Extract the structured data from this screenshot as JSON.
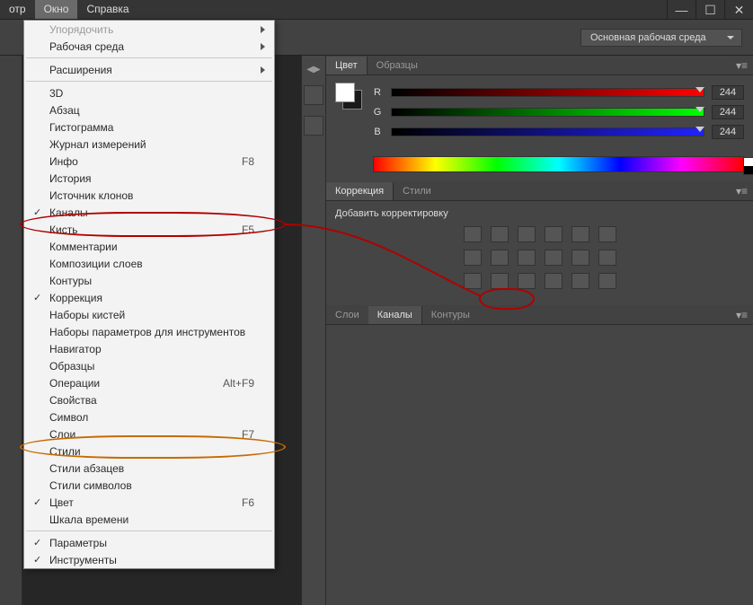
{
  "menubar": {
    "truncated_item": "отр",
    "window": "Окно",
    "help": "Справка"
  },
  "window_controls": {
    "min": "—",
    "restore": "☐",
    "close": "✕"
  },
  "workspace_selector": "Основная рабочая среда",
  "dropdown": {
    "arrange": "Упорядочить",
    "workspace_env": "Рабочая среда",
    "extensions": "Расширения",
    "three_d": "3D",
    "paragraph": "Абзац",
    "histogram": "Гистограмма",
    "measure_log": "Журнал измерений",
    "info": "Инфо",
    "info_sc": "F8",
    "history": "История",
    "clone_source": "Источник клонов",
    "channels": "Каналы",
    "brush": "Кисть",
    "brush_sc": "F5",
    "comments": "Комментарии",
    "layer_comps": "Композиции слоев",
    "paths": "Контуры",
    "adjustments": "Коррекция",
    "brush_presets": "Наборы кистей",
    "tool_presets": "Наборы параметров для инструментов",
    "navigator": "Навигатор",
    "swatches": "Образцы",
    "actions": "Операции",
    "actions_sc": "Alt+F9",
    "properties": "Свойства",
    "character": "Символ",
    "layers": "Слои",
    "layers_sc": "F7",
    "styles": "Стили",
    "para_styles": "Стили абзацев",
    "char_styles": "Стили символов",
    "color": "Цвет",
    "color_sc": "F6",
    "timeline": "Шкала времени",
    "options": "Параметры",
    "tools": "Инструменты"
  },
  "panels": {
    "color_tab": "Цвет",
    "swatches_tab": "Образцы",
    "rgb": {
      "r": "R",
      "g": "G",
      "b": "B",
      "rv": "244",
      "gv": "244",
      "bv": "244"
    },
    "correction_tab": "Коррекция",
    "styles_tab": "Стили",
    "add_adjustment": "Добавить корректировку",
    "layers_tab": "Слои",
    "channels_tab": "Каналы",
    "paths_tab": "Контуры"
  }
}
